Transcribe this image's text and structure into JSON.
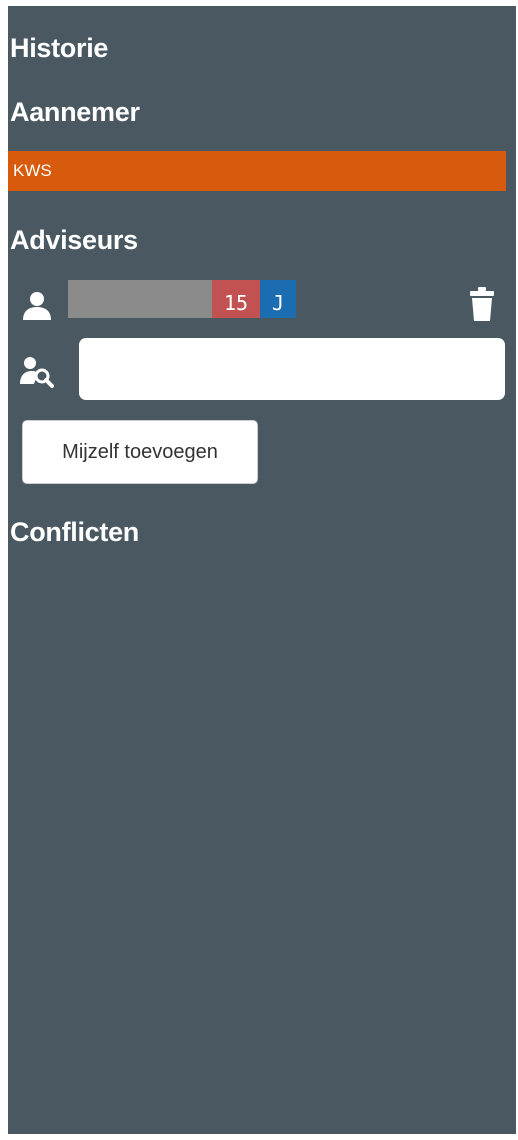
{
  "sections": {
    "history_title": "Historie",
    "contractor_title": "Aannemer",
    "advisors_title": "Adviseurs",
    "conflicts_title": "Conflicten"
  },
  "contractor": {
    "name": "KWS",
    "color": "#d85a0c"
  },
  "advisors": [
    {
      "count_badge": "15",
      "initial_badge": "J",
      "count_color": "#c25152",
      "initial_color": "#1c6cb2",
      "icon": "person-icon",
      "action_icon": "trash-icon"
    }
  ],
  "advisor_search": {
    "icon": "user-search-icon",
    "value": "",
    "placeholder": ""
  },
  "add_self_button": {
    "label": "Mijzelf toevoegen"
  },
  "colors": {
    "panel_background": "#4a5961",
    "text": "#ffffff"
  }
}
